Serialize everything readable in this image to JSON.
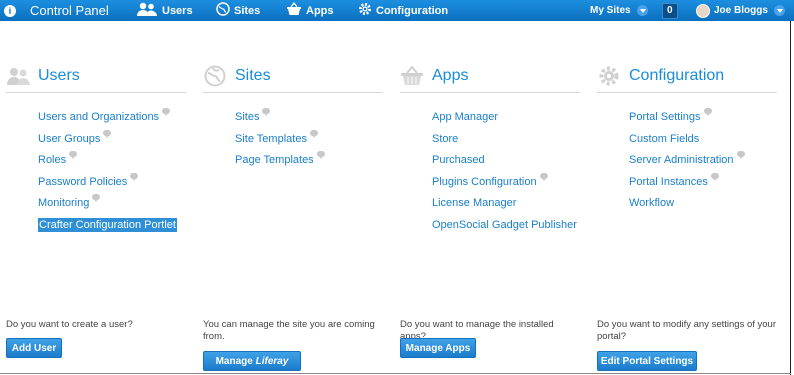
{
  "topbar": {
    "title": "Control Panel",
    "nav": {
      "users": "Users",
      "sites": "Sites",
      "apps": "Apps",
      "configuration": "Configuration"
    },
    "my_sites": "My Sites",
    "notification_count": "0",
    "user_name": "Joe Bloggs"
  },
  "columns": {
    "users": {
      "title": "Users",
      "icon": "users-icon",
      "links": [
        "Users and Organizations",
        "User Groups",
        "Roles",
        "Password Policies",
        "Monitoring",
        "Crafter Configuration Portlet"
      ],
      "prompt": "Do you want to create a user?",
      "button": "Add User"
    },
    "sites": {
      "title": "Sites",
      "icon": "globe-icon",
      "links": [
        "Sites",
        "Site Templates",
        "Page Templates"
      ],
      "prompt": "You can manage the site you are coming from.",
      "button_prefix": "Manage ",
      "button_site": "Liferay"
    },
    "apps": {
      "title": "Apps",
      "icon": "basket-icon",
      "links": [
        "App Manager",
        "Store",
        "Purchased",
        "Plugins Configuration",
        "License Manager",
        "OpenSocial Gadget Publisher"
      ],
      "prompt": "Do you want to manage the installed apps?",
      "button": "Manage Apps"
    },
    "configuration": {
      "title": "Configuration",
      "icon": "gear-icon",
      "links": [
        "Portal Settings",
        "Custom Fields",
        "Server Administration",
        "Portal Instances",
        "Workflow"
      ],
      "prompt": "Do you want to modify any settings of your portal?",
      "button": "Edit Portal Settings"
    }
  },
  "colors": {
    "topbar": "#0b6fbe",
    "link": "#1a7fc8",
    "heading": "#1a8cd8",
    "selected": "#2e8fd6"
  }
}
